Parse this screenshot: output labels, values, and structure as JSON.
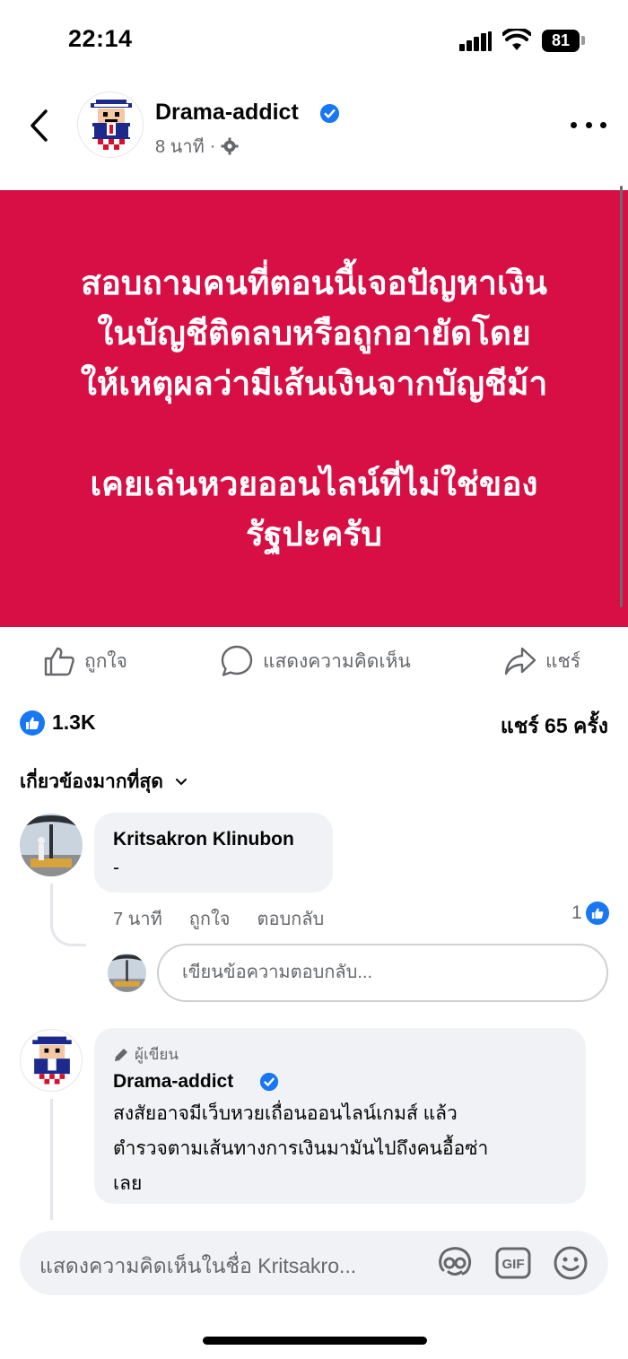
{
  "status_bar": {
    "time": "22:14",
    "battery": "81"
  },
  "header": {
    "page_name": "Drama-addict",
    "time_ago": "8 นาที",
    "separator": "·"
  },
  "post": {
    "text": "สอบถามคนที่ตอนนี้เจอปัญหาเงิน\nในบัญชีติดลบหรือถูกอายัดโดย\nให้เหตุผลว่ามีเส้นเงินจากบัญชีม้า\n\nเคยเล่นหวยออนไลน์ที่ไม่ใช่ของ\nรัฐปะครับ",
    "background_color": "#d80f45"
  },
  "actions": {
    "like": "ถูกใจ",
    "comment": "แสดงความคิดเห็น",
    "share": "แชร์"
  },
  "summary": {
    "likes": "1.3K",
    "shares": "แชร์ 65 ครั้ง"
  },
  "sort": {
    "label": "เกี่ยวข้องมากที่สุด"
  },
  "comments": [
    {
      "name": "Kritsakron Klinubon",
      "text": "-",
      "time": "7 นาที",
      "like_label": "ถูกใจ",
      "reply_label": "ตอบกลับ",
      "reactions": "1",
      "reply_placeholder": "เขียนข้อความตอบกลับ..."
    },
    {
      "author_badge": "ผู้เขียน",
      "name": "Drama-addict",
      "text": "สงสัยอาจมีเว็บหวยเถื่อนออนไลน์เกมส์ แล้ว\nตำรวจตามเส้นทางการเงินมามันไปถึงคนอื้อซ่า\nเลย"
    }
  ],
  "composer": {
    "placeholder": "แสดงความคิดเห็นในชื่อ Kritsakro..."
  },
  "colors": {
    "accent": "#1877f2",
    "muted": "#65676b",
    "bubble": "#f0f2f5"
  }
}
